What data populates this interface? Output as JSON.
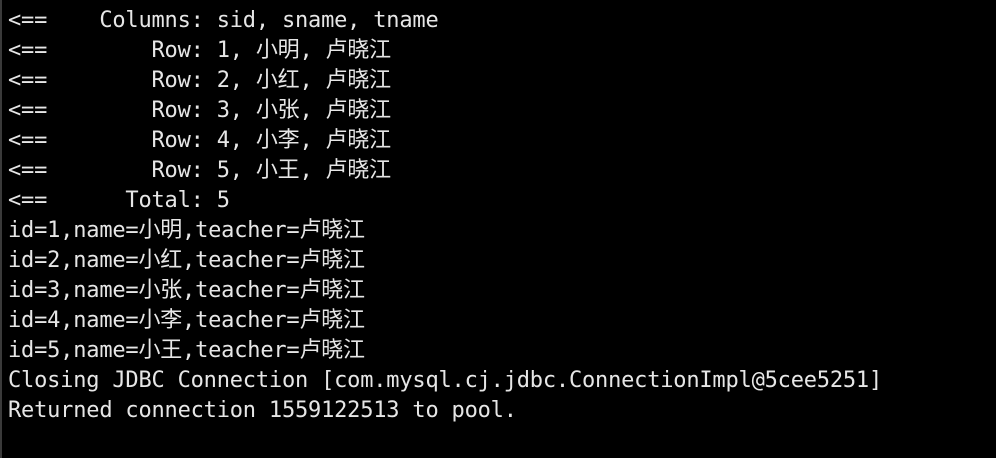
{
  "console": {
    "lines": [
      "<==    Columns: sid, sname, tname",
      "<==        Row: 1, 小明, 卢晓江",
      "<==        Row: 2, 小红, 卢晓江",
      "<==        Row: 3, 小张, 卢晓江",
      "<==        Row: 4, 小李, 卢晓江",
      "<==        Row: 5, 小王, 卢晓江",
      "<==      Total: 5",
      "id=1,name=小明,teacher=卢晓江",
      "id=2,name=小红,teacher=卢晓江",
      "id=3,name=小张,teacher=卢晓江",
      "id=4,name=小李,teacher=卢晓江",
      "id=5,name=小王,teacher=卢晓江",
      "Closing JDBC Connection [com.mysql.cj.jdbc.ConnectionImpl@5cee5251]",
      "Returned connection 1559122513 to pool."
    ]
  }
}
